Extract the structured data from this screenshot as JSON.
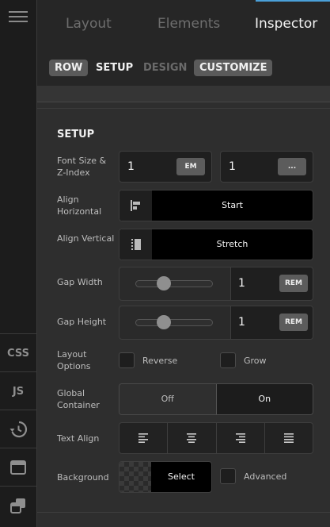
{
  "rail": {
    "css_label": "CSS",
    "js_label": "JS"
  },
  "tabs": {
    "layout": "Layout",
    "elements": "Elements",
    "inspector": "Inspector",
    "active": "Inspector",
    "accent_color": "#4aa0d8"
  },
  "subtabs": {
    "row": "ROW",
    "setup": "SETUP",
    "design": "DESIGN",
    "customize": "CUSTOMIZE"
  },
  "setup": {
    "title": "SETUP",
    "font_size": {
      "label": "Font Size & Z-Index",
      "font_value": "1",
      "font_unit": "EM",
      "z_value": "1",
      "z_unit": "..."
    },
    "align_horizontal": {
      "label": "Align Horizontal",
      "value": "Start"
    },
    "align_vertical": {
      "label": "Align Vertical",
      "value": "Stretch"
    },
    "gap_width": {
      "label": "Gap Width",
      "value": "1",
      "unit": "REM",
      "slider_fraction": 0.37
    },
    "gap_height": {
      "label": "Gap Height",
      "value": "1",
      "unit": "REM",
      "slider_fraction": 0.37
    },
    "layout_options": {
      "label": "Layout Options",
      "reverse": "Reverse",
      "grow": "Grow",
      "reverse_checked": false,
      "grow_checked": false
    },
    "global_container": {
      "label": "Global Container",
      "off": "Off",
      "on": "On",
      "selected": "On"
    },
    "text_align": {
      "label": "Text Align",
      "options": [
        "left",
        "center",
        "right",
        "justify"
      ]
    },
    "background": {
      "label": "Background",
      "select": "Select",
      "advanced": "Advanced",
      "advanced_checked": false
    }
  }
}
